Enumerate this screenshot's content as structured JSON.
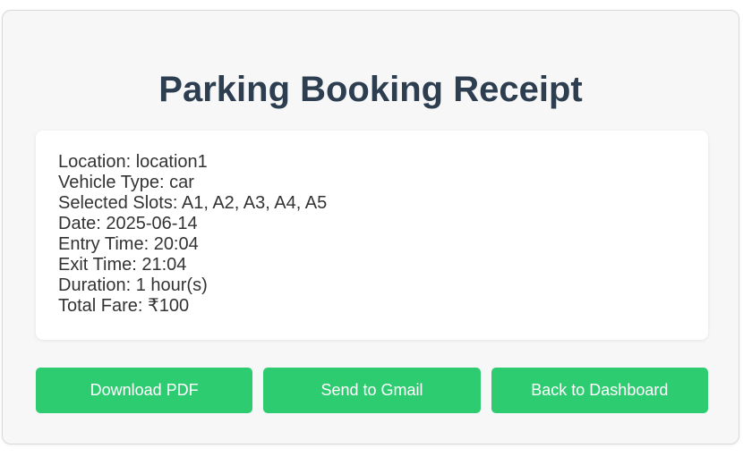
{
  "receipt": {
    "title": "Parking Booking Receipt",
    "details": [
      "Location: location1",
      "Vehicle Type: car",
      "Selected Slots: A1, A2, A3, A4, A5",
      "Date: 2025-06-14",
      "Entry Time: 20:04",
      "Exit Time: 21:04",
      "Duration: 1 hour(s)",
      "Total Fare: ₹100"
    ]
  },
  "actions": {
    "download_label": "Download PDF",
    "gmail_label": "Send to Gmail",
    "dashboard_label": "Back to Dashboard"
  },
  "colors": {
    "title": "#2c3e50",
    "button": "#2ecc71",
    "card_bg": "#f7f7f7"
  }
}
